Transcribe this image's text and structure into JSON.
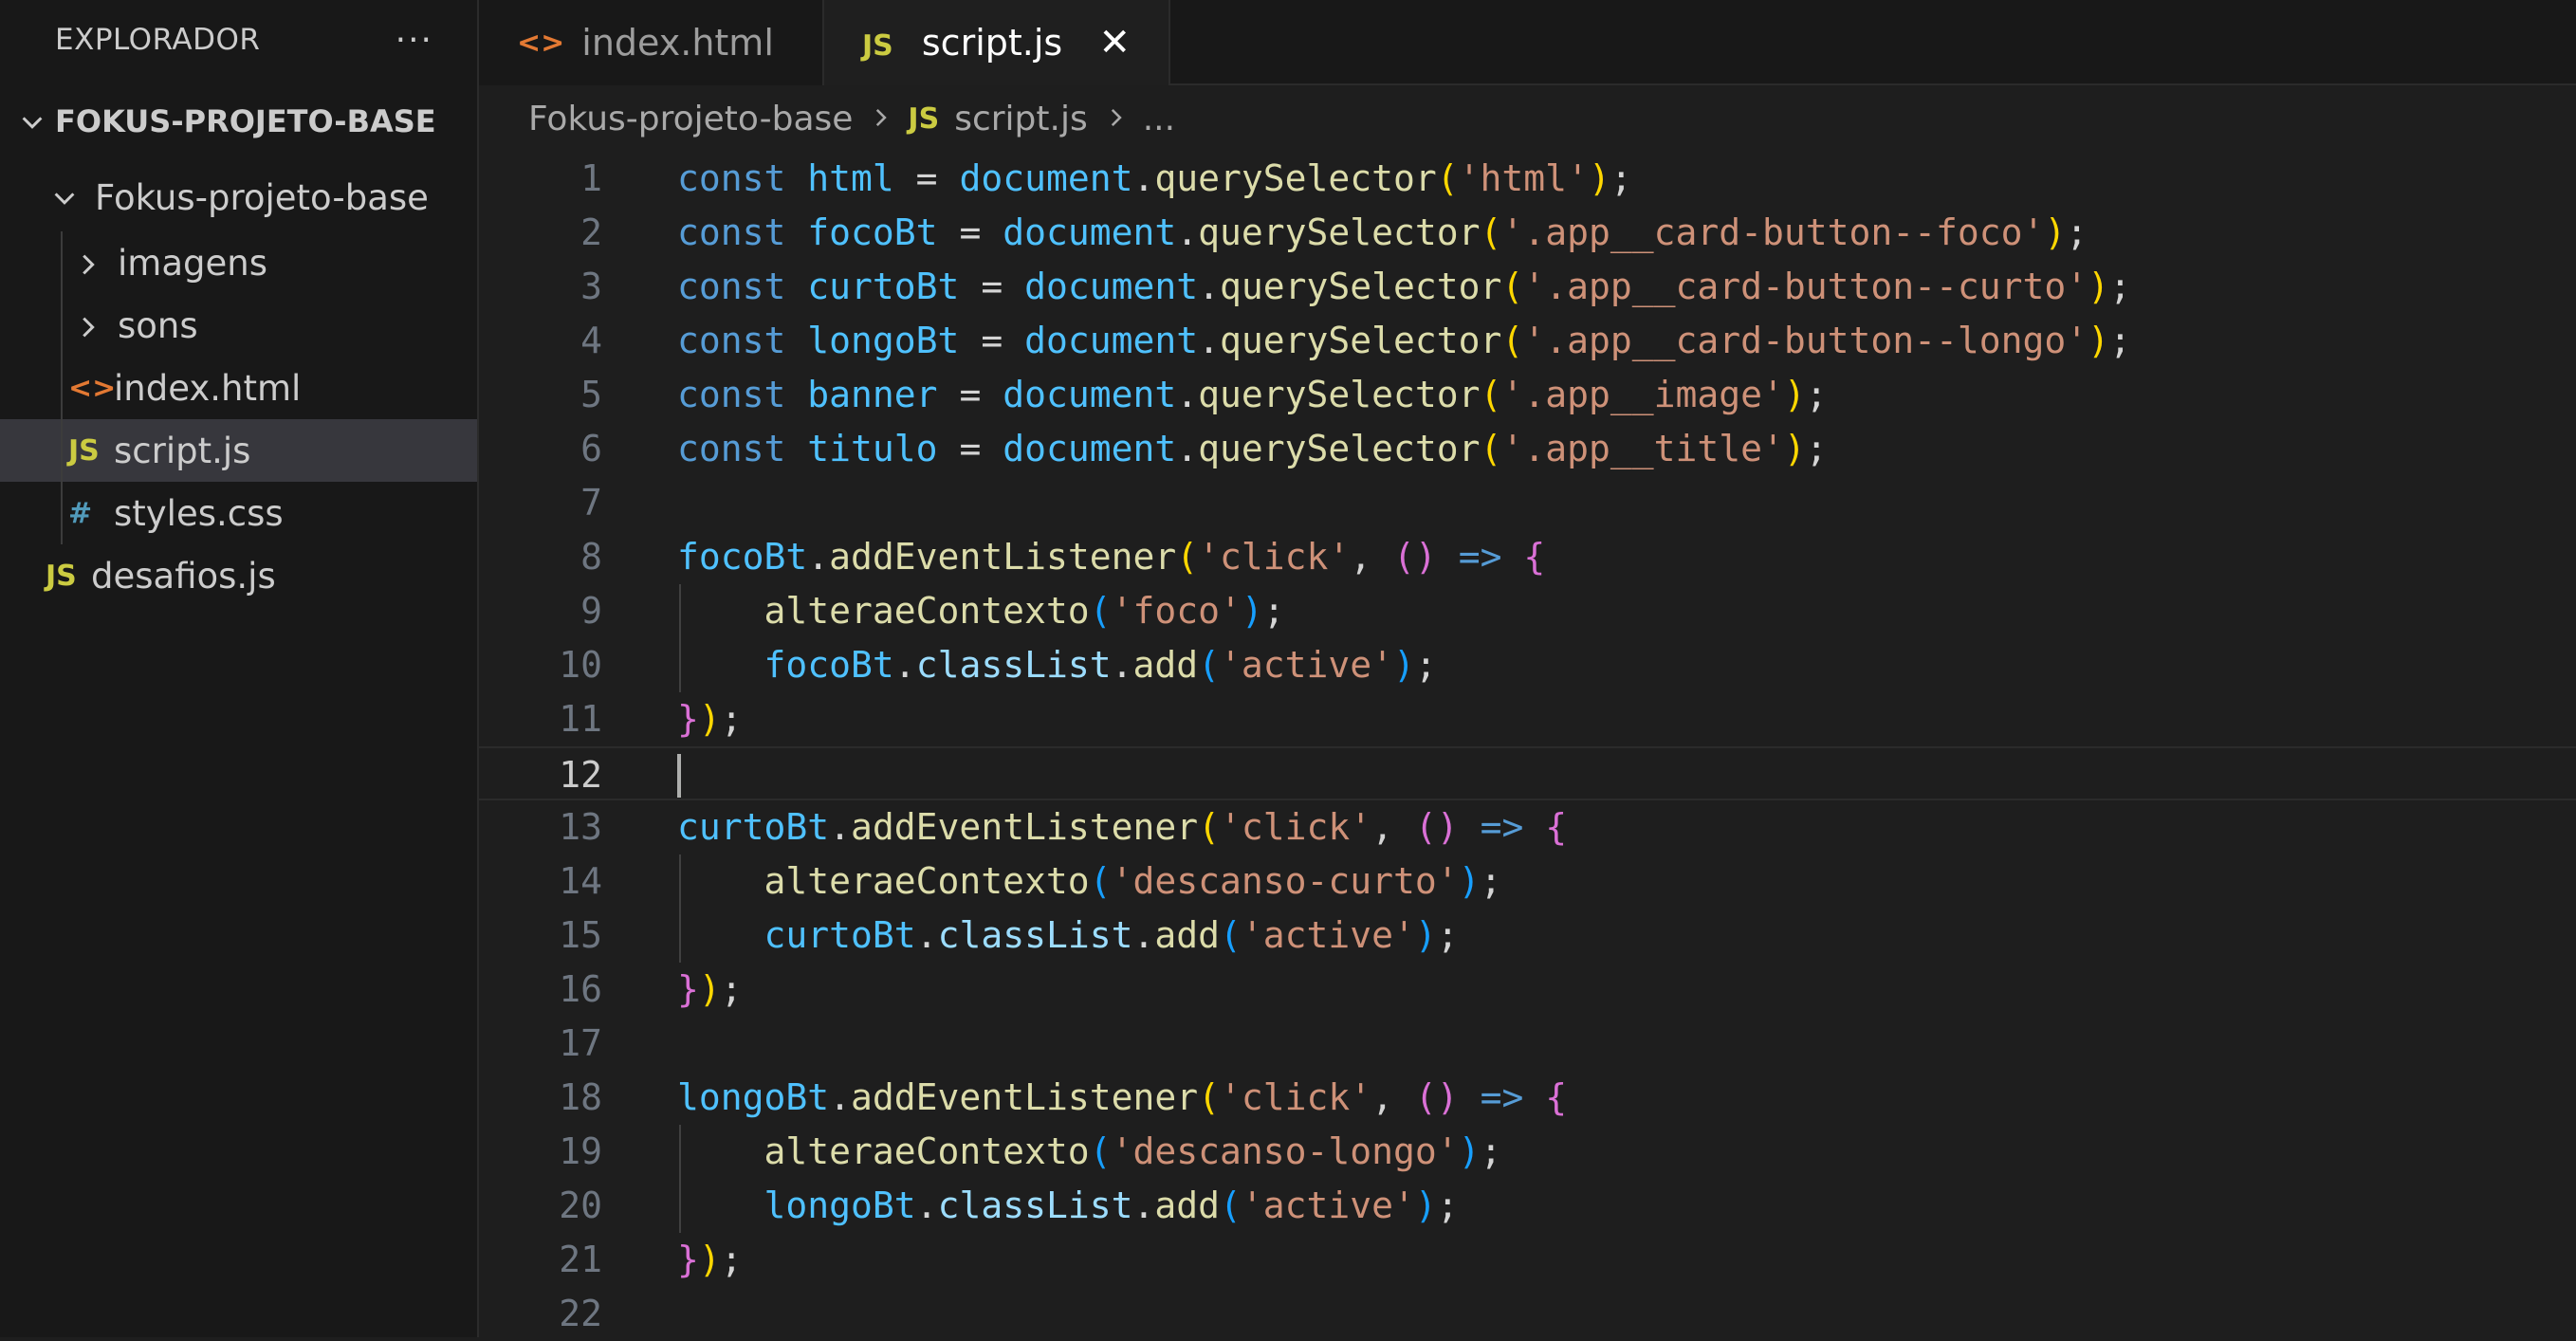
{
  "sidebar": {
    "title": "EXPLORADOR",
    "more": "···",
    "root": "FOKUS-PROJETO-BASE",
    "folder": "Fokus-projeto-base",
    "items": [
      {
        "label": "imagens",
        "type": "folder"
      },
      {
        "label": "sons",
        "type": "folder"
      },
      {
        "label": "index.html",
        "type": "html"
      },
      {
        "label": "script.js",
        "type": "js"
      },
      {
        "label": "styles.css",
        "type": "css"
      }
    ],
    "extra": {
      "label": "desafios.js",
      "type": "js"
    }
  },
  "tabs": [
    {
      "label": "index.html",
      "icon": "<>",
      "active": false
    },
    {
      "label": "script.js",
      "icon": "JS",
      "active": true
    }
  ],
  "tab_close": "✕",
  "breadcrumb": {
    "folder": "Fokus-projeto-base",
    "file": "script.js",
    "ellipsis": "...",
    "js_icon": "JS"
  },
  "icons": {
    "js": "JS",
    "html": "<>",
    "css": "#"
  },
  "editor": {
    "current_line": 12,
    "lines": [
      [
        [
          "kw",
          "const "
        ],
        [
          "var",
          "html"
        ],
        [
          "pn",
          " = "
        ],
        [
          "var",
          "document"
        ],
        [
          "pn",
          "."
        ],
        [
          "fn",
          "querySelector"
        ],
        [
          "b1",
          "("
        ],
        [
          "str",
          "'html'"
        ],
        [
          "b1",
          ")"
        ],
        [
          "pn",
          ";"
        ]
      ],
      [
        [
          "kw",
          "const "
        ],
        [
          "var",
          "focoBt"
        ],
        [
          "pn",
          " = "
        ],
        [
          "var",
          "document"
        ],
        [
          "pn",
          "."
        ],
        [
          "fn",
          "querySelector"
        ],
        [
          "b1",
          "("
        ],
        [
          "str",
          "'.app__card-button--foco'"
        ],
        [
          "b1",
          ")"
        ],
        [
          "pn",
          ";"
        ]
      ],
      [
        [
          "kw",
          "const "
        ],
        [
          "var",
          "curtoBt"
        ],
        [
          "pn",
          " = "
        ],
        [
          "var",
          "document"
        ],
        [
          "pn",
          "."
        ],
        [
          "fn",
          "querySelector"
        ],
        [
          "b1",
          "("
        ],
        [
          "str",
          "'.app__card-button--curto'"
        ],
        [
          "b1",
          ")"
        ],
        [
          "pn",
          ";"
        ]
      ],
      [
        [
          "kw",
          "const "
        ],
        [
          "var",
          "longoBt"
        ],
        [
          "pn",
          " = "
        ],
        [
          "var",
          "document"
        ],
        [
          "pn",
          "."
        ],
        [
          "fn",
          "querySelector"
        ],
        [
          "b1",
          "("
        ],
        [
          "str",
          "'.app__card-button--longo'"
        ],
        [
          "b1",
          ")"
        ],
        [
          "pn",
          ";"
        ]
      ],
      [
        [
          "kw",
          "const "
        ],
        [
          "var",
          "banner"
        ],
        [
          "pn",
          " = "
        ],
        [
          "var",
          "document"
        ],
        [
          "pn",
          "."
        ],
        [
          "fn",
          "querySelector"
        ],
        [
          "b1",
          "("
        ],
        [
          "str",
          "'.app__image'"
        ],
        [
          "b1",
          ")"
        ],
        [
          "pn",
          ";"
        ]
      ],
      [
        [
          "kw",
          "const "
        ],
        [
          "var",
          "titulo"
        ],
        [
          "pn",
          " = "
        ],
        [
          "var",
          "document"
        ],
        [
          "pn",
          "."
        ],
        [
          "fn",
          "querySelector"
        ],
        [
          "b1",
          "("
        ],
        [
          "str",
          "'.app__title'"
        ],
        [
          "b1",
          ")"
        ],
        [
          "pn",
          ";"
        ]
      ],
      [],
      [
        [
          "var",
          "focoBt"
        ],
        [
          "pn",
          "."
        ],
        [
          "fn",
          "addEventListener"
        ],
        [
          "b1",
          "("
        ],
        [
          "str",
          "'click'"
        ],
        [
          "pn",
          ", "
        ],
        [
          "b2",
          "()"
        ],
        [
          "pn",
          " "
        ],
        [
          "kw",
          "=>"
        ],
        [
          "pn",
          " "
        ],
        [
          "b2",
          "{"
        ]
      ],
      [
        [
          "pn",
          "    "
        ],
        [
          "fn",
          "alteraeContexto"
        ],
        [
          "b3",
          "("
        ],
        [
          "str",
          "'foco'"
        ],
        [
          "b3",
          ")"
        ],
        [
          "pn",
          ";"
        ]
      ],
      [
        [
          "pn",
          "    "
        ],
        [
          "var",
          "focoBt"
        ],
        [
          "pn",
          "."
        ],
        [
          "prop",
          "classList"
        ],
        [
          "pn",
          "."
        ],
        [
          "fn",
          "add"
        ],
        [
          "b3",
          "("
        ],
        [
          "str",
          "'active'"
        ],
        [
          "b3",
          ")"
        ],
        [
          "pn",
          ";"
        ]
      ],
      [
        [
          "b2",
          "}"
        ],
        [
          "b1",
          ")"
        ],
        [
          "pn",
          ";"
        ]
      ],
      [],
      [
        [
          "var",
          "curtoBt"
        ],
        [
          "pn",
          "."
        ],
        [
          "fn",
          "addEventListener"
        ],
        [
          "b1",
          "("
        ],
        [
          "str",
          "'click'"
        ],
        [
          "pn",
          ", "
        ],
        [
          "b2",
          "()"
        ],
        [
          "pn",
          " "
        ],
        [
          "kw",
          "=>"
        ],
        [
          "pn",
          " "
        ],
        [
          "b2",
          "{"
        ]
      ],
      [
        [
          "pn",
          "    "
        ],
        [
          "fn",
          "alteraeContexto"
        ],
        [
          "b3",
          "("
        ],
        [
          "str",
          "'descanso-curto'"
        ],
        [
          "b3",
          ")"
        ],
        [
          "pn",
          ";"
        ]
      ],
      [
        [
          "pn",
          "    "
        ],
        [
          "var",
          "curtoBt"
        ],
        [
          "pn",
          "."
        ],
        [
          "prop",
          "classList"
        ],
        [
          "pn",
          "."
        ],
        [
          "fn",
          "add"
        ],
        [
          "b3",
          "("
        ],
        [
          "str",
          "'active'"
        ],
        [
          "b3",
          ")"
        ],
        [
          "pn",
          ";"
        ]
      ],
      [
        [
          "b2",
          "}"
        ],
        [
          "b1",
          ")"
        ],
        [
          "pn",
          ";"
        ]
      ],
      [],
      [
        [
          "var",
          "longoBt"
        ],
        [
          "pn",
          "."
        ],
        [
          "fn",
          "addEventListener"
        ],
        [
          "b1",
          "("
        ],
        [
          "str",
          "'click'"
        ],
        [
          "pn",
          ", "
        ],
        [
          "b2",
          "()"
        ],
        [
          "pn",
          " "
        ],
        [
          "kw",
          "=>"
        ],
        [
          "pn",
          " "
        ],
        [
          "b2",
          "{"
        ]
      ],
      [
        [
          "pn",
          "    "
        ],
        [
          "fn",
          "alteraeContexto"
        ],
        [
          "b3",
          "("
        ],
        [
          "str",
          "'descanso-longo'"
        ],
        [
          "b3",
          ")"
        ],
        [
          "pn",
          ";"
        ]
      ],
      [
        [
          "pn",
          "    "
        ],
        [
          "var",
          "longoBt"
        ],
        [
          "pn",
          "."
        ],
        [
          "prop",
          "classList"
        ],
        [
          "pn",
          "."
        ],
        [
          "fn",
          "add"
        ],
        [
          "b3",
          "("
        ],
        [
          "str",
          "'active'"
        ],
        [
          "b3",
          ")"
        ],
        [
          "pn",
          ";"
        ]
      ],
      [
        [
          "b2",
          "}"
        ],
        [
          "b1",
          ")"
        ],
        [
          "pn",
          ";"
        ]
      ],
      []
    ]
  }
}
